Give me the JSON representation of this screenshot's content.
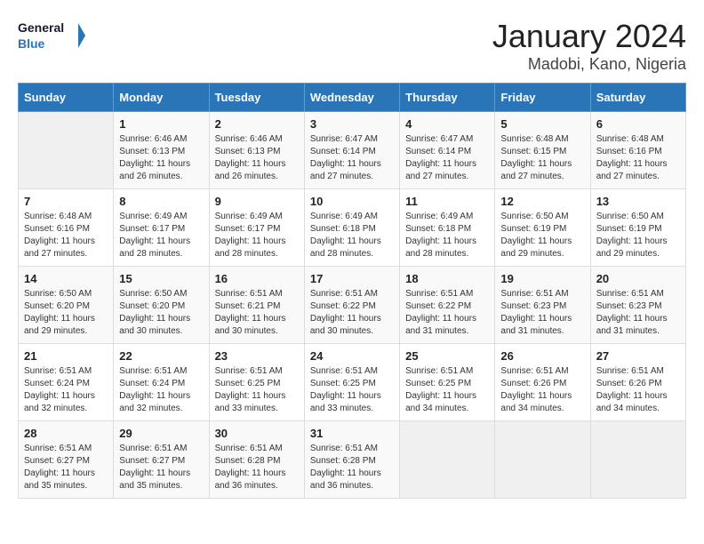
{
  "logo": {
    "line1": "General",
    "line2": "Blue"
  },
  "title": "January 2024",
  "location": "Madobi, Kano, Nigeria",
  "days_of_week": [
    "Sunday",
    "Monday",
    "Tuesday",
    "Wednesday",
    "Thursday",
    "Friday",
    "Saturday"
  ],
  "weeks": [
    [
      {
        "day": "",
        "info": ""
      },
      {
        "day": "1",
        "info": "Sunrise: 6:46 AM\nSunset: 6:13 PM\nDaylight: 11 hours and 26 minutes."
      },
      {
        "day": "2",
        "info": "Sunrise: 6:46 AM\nSunset: 6:13 PM\nDaylight: 11 hours and 26 minutes."
      },
      {
        "day": "3",
        "info": "Sunrise: 6:47 AM\nSunset: 6:14 PM\nDaylight: 11 hours and 27 minutes."
      },
      {
        "day": "4",
        "info": "Sunrise: 6:47 AM\nSunset: 6:14 PM\nDaylight: 11 hours and 27 minutes."
      },
      {
        "day": "5",
        "info": "Sunrise: 6:48 AM\nSunset: 6:15 PM\nDaylight: 11 hours and 27 minutes."
      },
      {
        "day": "6",
        "info": "Sunrise: 6:48 AM\nSunset: 6:16 PM\nDaylight: 11 hours and 27 minutes."
      }
    ],
    [
      {
        "day": "7",
        "info": "Sunrise: 6:48 AM\nSunset: 6:16 PM\nDaylight: 11 hours and 27 minutes."
      },
      {
        "day": "8",
        "info": "Sunrise: 6:49 AM\nSunset: 6:17 PM\nDaylight: 11 hours and 28 minutes."
      },
      {
        "day": "9",
        "info": "Sunrise: 6:49 AM\nSunset: 6:17 PM\nDaylight: 11 hours and 28 minutes."
      },
      {
        "day": "10",
        "info": "Sunrise: 6:49 AM\nSunset: 6:18 PM\nDaylight: 11 hours and 28 minutes."
      },
      {
        "day": "11",
        "info": "Sunrise: 6:49 AM\nSunset: 6:18 PM\nDaylight: 11 hours and 28 minutes."
      },
      {
        "day": "12",
        "info": "Sunrise: 6:50 AM\nSunset: 6:19 PM\nDaylight: 11 hours and 29 minutes."
      },
      {
        "day": "13",
        "info": "Sunrise: 6:50 AM\nSunset: 6:19 PM\nDaylight: 11 hours and 29 minutes."
      }
    ],
    [
      {
        "day": "14",
        "info": "Sunrise: 6:50 AM\nSunset: 6:20 PM\nDaylight: 11 hours and 29 minutes."
      },
      {
        "day": "15",
        "info": "Sunrise: 6:50 AM\nSunset: 6:20 PM\nDaylight: 11 hours and 30 minutes."
      },
      {
        "day": "16",
        "info": "Sunrise: 6:51 AM\nSunset: 6:21 PM\nDaylight: 11 hours and 30 minutes."
      },
      {
        "day": "17",
        "info": "Sunrise: 6:51 AM\nSunset: 6:22 PM\nDaylight: 11 hours and 30 minutes."
      },
      {
        "day": "18",
        "info": "Sunrise: 6:51 AM\nSunset: 6:22 PM\nDaylight: 11 hours and 31 minutes."
      },
      {
        "day": "19",
        "info": "Sunrise: 6:51 AM\nSunset: 6:23 PM\nDaylight: 11 hours and 31 minutes."
      },
      {
        "day": "20",
        "info": "Sunrise: 6:51 AM\nSunset: 6:23 PM\nDaylight: 11 hours and 31 minutes."
      }
    ],
    [
      {
        "day": "21",
        "info": "Sunrise: 6:51 AM\nSunset: 6:24 PM\nDaylight: 11 hours and 32 minutes."
      },
      {
        "day": "22",
        "info": "Sunrise: 6:51 AM\nSunset: 6:24 PM\nDaylight: 11 hours and 32 minutes."
      },
      {
        "day": "23",
        "info": "Sunrise: 6:51 AM\nSunset: 6:25 PM\nDaylight: 11 hours and 33 minutes."
      },
      {
        "day": "24",
        "info": "Sunrise: 6:51 AM\nSunset: 6:25 PM\nDaylight: 11 hours and 33 minutes."
      },
      {
        "day": "25",
        "info": "Sunrise: 6:51 AM\nSunset: 6:25 PM\nDaylight: 11 hours and 34 minutes."
      },
      {
        "day": "26",
        "info": "Sunrise: 6:51 AM\nSunset: 6:26 PM\nDaylight: 11 hours and 34 minutes."
      },
      {
        "day": "27",
        "info": "Sunrise: 6:51 AM\nSunset: 6:26 PM\nDaylight: 11 hours and 34 minutes."
      }
    ],
    [
      {
        "day": "28",
        "info": "Sunrise: 6:51 AM\nSunset: 6:27 PM\nDaylight: 11 hours and 35 minutes."
      },
      {
        "day": "29",
        "info": "Sunrise: 6:51 AM\nSunset: 6:27 PM\nDaylight: 11 hours and 35 minutes."
      },
      {
        "day": "30",
        "info": "Sunrise: 6:51 AM\nSunset: 6:28 PM\nDaylight: 11 hours and 36 minutes."
      },
      {
        "day": "31",
        "info": "Sunrise: 6:51 AM\nSunset: 6:28 PM\nDaylight: 11 hours and 36 minutes."
      },
      {
        "day": "",
        "info": ""
      },
      {
        "day": "",
        "info": ""
      },
      {
        "day": "",
        "info": ""
      }
    ]
  ]
}
